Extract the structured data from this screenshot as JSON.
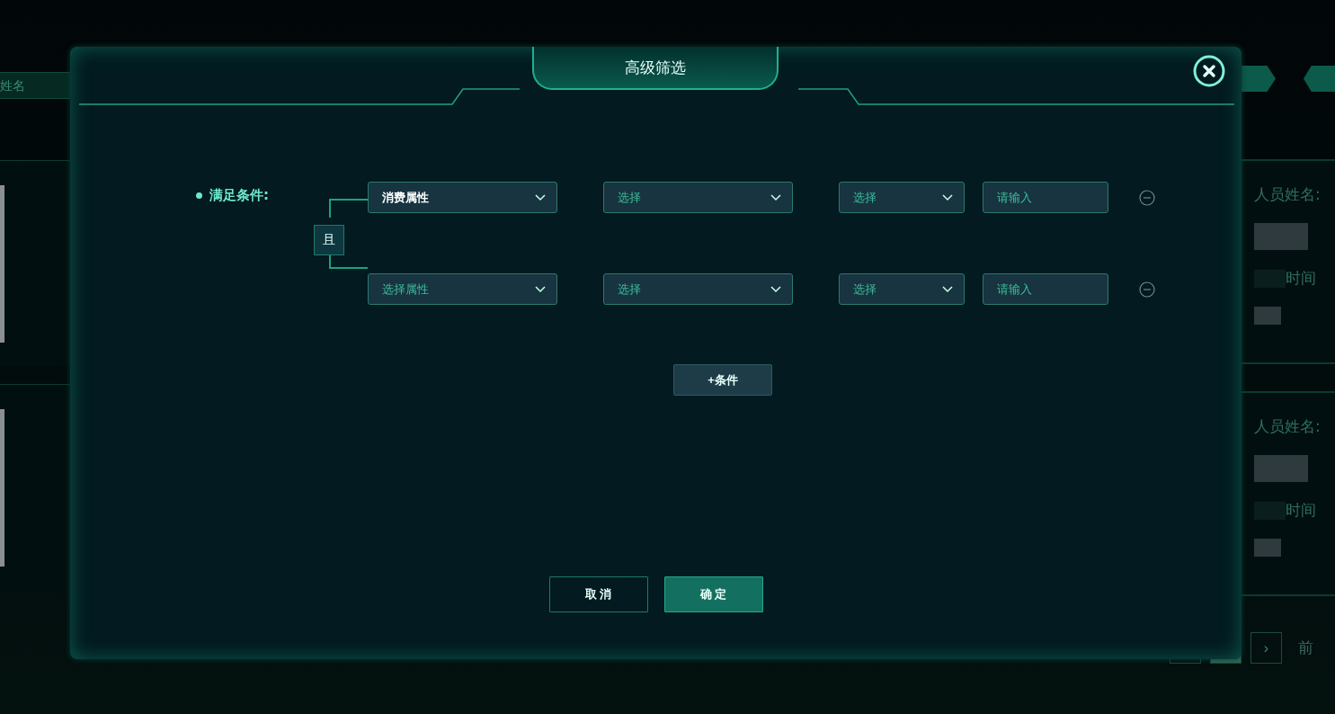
{
  "background": {
    "search_field": {
      "placeholder": "姓名"
    },
    "cards": [
      {
        "label": "人员姓名:",
        "time_label": "时间"
      },
      {
        "label": "人员姓名:",
        "time_label": "时间"
      }
    ],
    "pagination": {
      "next": "›",
      "trailing_text": "前"
    }
  },
  "dialog": {
    "title": "高级筛选",
    "condition_label": "满足条件:",
    "logic": "且",
    "conditions": [
      {
        "attribute": {
          "value": "消费属性"
        },
        "operator": {
          "placeholder": "选择"
        },
        "comparison": {
          "placeholder": "选择"
        },
        "input": {
          "placeholder": "请输入"
        }
      },
      {
        "attribute": {
          "placeholder": "选择属性"
        },
        "operator": {
          "placeholder": "选择"
        },
        "comparison": {
          "placeholder": "选择"
        },
        "input": {
          "placeholder": "请输入"
        }
      }
    ],
    "add_button": "+条件",
    "buttons": [
      {
        "label": "取 消",
        "kind": "secondary"
      },
      {
        "label": "确 定",
        "kind": "primary"
      }
    ]
  }
}
